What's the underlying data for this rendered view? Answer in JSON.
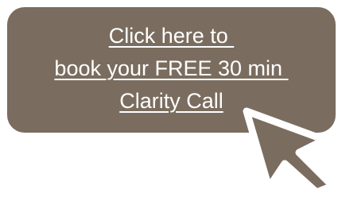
{
  "cta": {
    "lines": [
      "Click here to ",
      "book your FREE 30 min ",
      "Clarity Call"
    ]
  },
  "colors": {
    "button_background": "#7a6d5f",
    "button_text": "#ffffff",
    "cursor_fill": "#7a6d5f",
    "cursor_outline": "#ffffff"
  },
  "icons": {
    "cursor": "pointer-arrow-icon"
  }
}
